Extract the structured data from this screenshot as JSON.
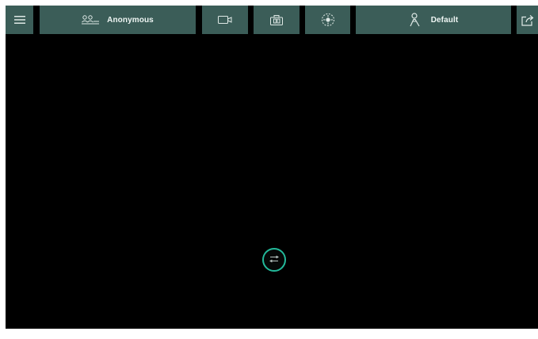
{
  "toolbar": {
    "menu_icon": "hamburger-menu-icon",
    "profile": {
      "icon": "profiles-icon",
      "label": "Anonymous"
    },
    "video_icon": "video-camera-icon",
    "photo_icon": "photo-camera-icon",
    "focus_icon": "crosshair-target-icon",
    "preset": {
      "icon": "person-preset-icon",
      "label": "Default"
    },
    "share_icon": "share-export-icon"
  },
  "viewport": {
    "status_icon": "swap-exchange-icon"
  },
  "colors": {
    "toolbar_bg": "#3b5d58",
    "viewport_bg": "#000000",
    "accent": "#23b99a",
    "frame": "#ffffff"
  }
}
